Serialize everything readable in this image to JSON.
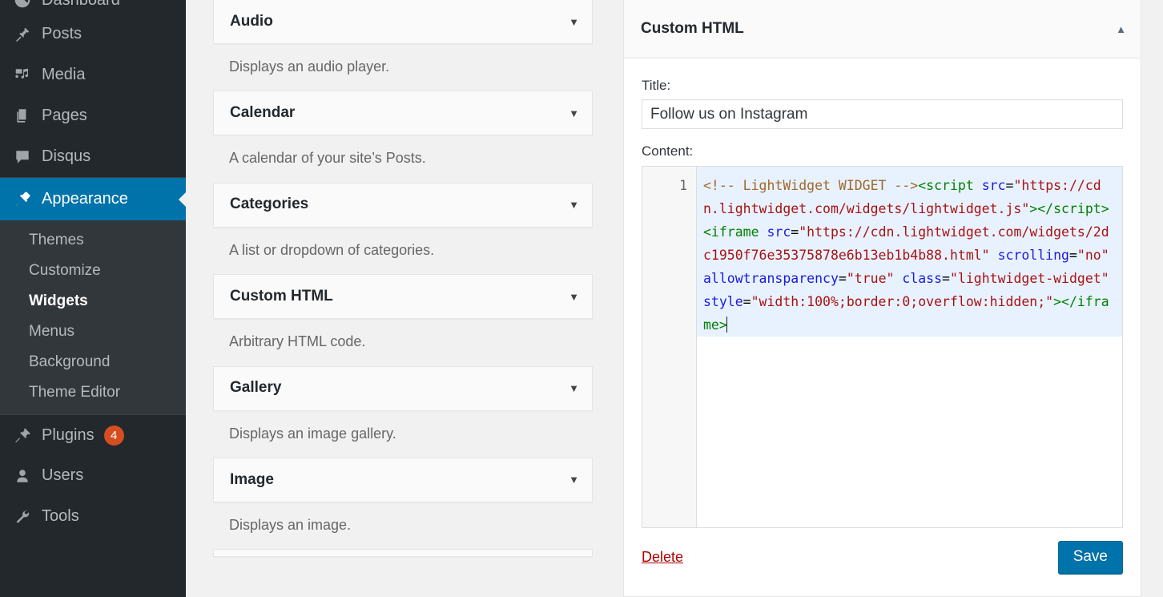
{
  "sidebar": {
    "top_items": [
      {
        "label": "Dashboard",
        "icon": "dashboard-icon",
        "current": false,
        "badge": null
      },
      {
        "label": "Posts",
        "icon": "pin-icon",
        "current": false,
        "badge": null
      },
      {
        "label": "Media",
        "icon": "media-icon",
        "current": false,
        "badge": null
      },
      {
        "label": "Pages",
        "icon": "pages-icon",
        "current": false,
        "badge": null
      },
      {
        "label": "Disqus",
        "icon": "comment-icon",
        "current": false,
        "badge": null
      },
      {
        "label": "Appearance",
        "icon": "paintbrush-icon",
        "current": true,
        "badge": null
      }
    ],
    "appearance_submenu": [
      {
        "label": "Themes",
        "current": false
      },
      {
        "label": "Customize",
        "current": false
      },
      {
        "label": "Widgets",
        "current": true
      },
      {
        "label": "Menus",
        "current": false
      },
      {
        "label": "Background",
        "current": false
      },
      {
        "label": "Theme Editor",
        "current": false
      }
    ],
    "bottom_items": [
      {
        "label": "Plugins",
        "icon": "plug-icon",
        "current": false,
        "badge": "4"
      },
      {
        "label": "Users",
        "icon": "user-icon",
        "current": false,
        "badge": null
      },
      {
        "label": "Tools",
        "icon": "wrench-icon",
        "current": false,
        "badge": null
      }
    ],
    "active_color": "#0073aa",
    "badge_color": "#d54e21",
    "background_color": "#23282d",
    "submenu_background_color": "#32373c"
  },
  "available_widgets": {
    "toggle_glyph": "▼",
    "items": [
      {
        "title": "Audio",
        "description": "Displays an audio player."
      },
      {
        "title": "Calendar",
        "description": "A calendar of your site’s Posts."
      },
      {
        "title": "Categories",
        "description": "A list or dropdown of categories."
      },
      {
        "title": "Custom HTML",
        "description": "Arbitrary HTML code."
      },
      {
        "title": "Gallery",
        "description": "Displays an image gallery."
      },
      {
        "title": "Image",
        "description": "Displays an image."
      }
    ]
  },
  "widget_panel": {
    "title": "Custom HTML",
    "toggle_glyph": "▲",
    "title_field": {
      "label": "Title:",
      "value": "Follow us on Instagram",
      "placeholder": ""
    },
    "content_field": {
      "label": "Content:",
      "line_number": "1",
      "raw_value": "<!-- LightWidget WIDGET --><script src=\"https://cdn.lightwidget.com/widgets/lightwidget.js\"></script><iframe src=\"https://cdn.lightwidget.com/widgets/2dc1950f76e35375878e6b13eb1b4b88.html\" scrolling=\"no\" allowtransparency=\"true\" class=\"lightwidget-widget\" style=\"width:100%;border:0;overflow:hidden;\"></iframe>",
      "tokens": [
        {
          "t": "comment",
          "v": "<!-- LightWidget WIDGET -->"
        },
        {
          "t": "tag",
          "v": "<script"
        },
        {
          "t": "plain",
          "v": " "
        },
        {
          "t": "attr",
          "v": "src"
        },
        {
          "t": "plain",
          "v": "="
        },
        {
          "t": "string",
          "v": "\"https://cdn.lightwidget.com/widgets/lightwidget.js\""
        },
        {
          "t": "tag",
          "v": ">"
        },
        {
          "t": "tag",
          "v": "</script>"
        },
        {
          "t": "tag",
          "v": "<iframe"
        },
        {
          "t": "plain",
          "v": " "
        },
        {
          "t": "attr",
          "v": "src"
        },
        {
          "t": "plain",
          "v": "="
        },
        {
          "t": "string",
          "v": "\"https://cdn.lightwidget.com/widgets/2dc1950f76e35375878e6b13eb1b4b88.html\""
        },
        {
          "t": "plain",
          "v": " "
        },
        {
          "t": "attr",
          "v": "scrolling"
        },
        {
          "t": "plain",
          "v": "="
        },
        {
          "t": "string",
          "v": "\"no\""
        },
        {
          "t": "plain",
          "v": " "
        },
        {
          "t": "attr",
          "v": "allowtransparency"
        },
        {
          "t": "plain",
          "v": "="
        },
        {
          "t": "string",
          "v": "\"true\""
        },
        {
          "t": "plain",
          "v": " "
        },
        {
          "t": "attr",
          "v": "class"
        },
        {
          "t": "plain",
          "v": "="
        },
        {
          "t": "string",
          "v": "\"lightwidget-widget\""
        },
        {
          "t": "plain",
          "v": " "
        },
        {
          "t": "attr",
          "v": "style"
        },
        {
          "t": "plain",
          "v": "="
        },
        {
          "t": "string",
          "v": "\"width:100%;border:0;overflow:hidden;\""
        },
        {
          "t": "tag",
          "v": ">"
        },
        {
          "t": "tag",
          "v": "</iframe>"
        }
      ],
      "colors": {
        "comment": "#a1682a",
        "tag": "#008000",
        "attribute": "#1a1ae0",
        "string": "#aa1111",
        "active_line_background": "#e8f2fe"
      }
    },
    "actions": {
      "delete_label": "Delete",
      "save_label": "Save",
      "save_color": "#0073aa",
      "delete_color": "#aa0000"
    }
  }
}
